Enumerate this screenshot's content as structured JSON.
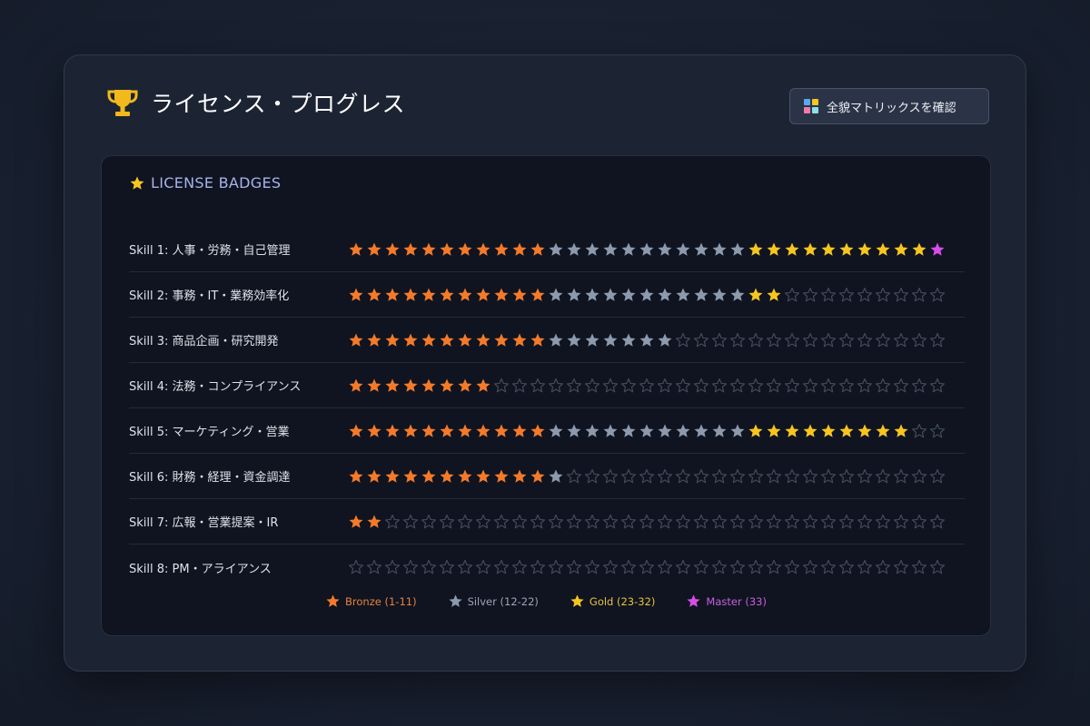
{
  "header": {
    "title": "ライセンス・プログレス",
    "trophy_icon": "trophy-icon",
    "matrix_button_label": "全貌マトリックスを確認",
    "matrix_icon": "grid-icon"
  },
  "badges_panel": {
    "title": "LICENSE BADGES",
    "title_icon": "star-icon",
    "total_stars": 33,
    "skills": [
      {
        "label": "Skill 1: 人事・労務・自己管理",
        "earned": 33
      },
      {
        "label": "Skill 2: 事務・IT・業務効率化",
        "earned": 24
      },
      {
        "label": "Skill 3: 商品企画・研究開発",
        "earned": 18
      },
      {
        "label": "Skill 4: 法務・コンプライアンス",
        "earned": 8
      },
      {
        "label": "Skill 5: マーケティング・営業",
        "earned": 31
      },
      {
        "label": "Skill 6: 財務・経理・資金調達",
        "earned": 12
      },
      {
        "label": "Skill 7: 広報・営業提案・IR",
        "earned": 2
      },
      {
        "label": "Skill 8: PM・アライアンス",
        "earned": 0
      }
    ],
    "legend": [
      {
        "label": "Bronze (1-11)",
        "tier": "bronze"
      },
      {
        "label": "Silver (12-22)",
        "tier": "silver"
      },
      {
        "label": "Gold (23-32)",
        "tier": "gold"
      },
      {
        "label": "Master (33)",
        "tier": "master"
      }
    ]
  },
  "colors": {
    "bronze": "#f47a2a",
    "silver": "#8d99ad",
    "gold": "#f7c520",
    "master": "#d84dea",
    "empty_outline": "#414a5c",
    "trophy": "#f2b91c",
    "legend_bronze_text": "#e8813a",
    "legend_silver_text": "#9aa5b7",
    "legend_gold_text": "#e9c13a",
    "legend_master_text": "#c95fe0"
  }
}
